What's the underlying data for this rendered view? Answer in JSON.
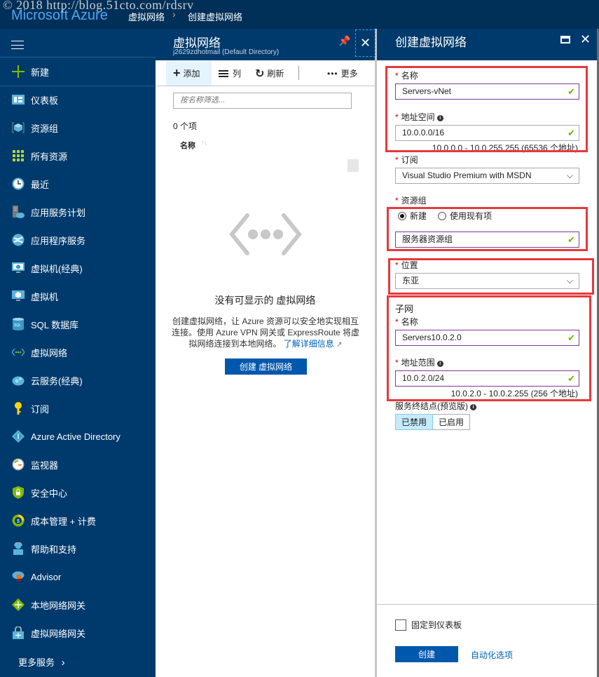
{
  "watermark": "© 2018 http://blog.51cto.com/rdsrv",
  "topbar": {
    "brand": "Microsoft Azure",
    "breadcrumb": [
      "虚拟网络",
      "创建虚拟网络"
    ],
    "breadcrumb_separator": "›"
  },
  "sidebar": {
    "new_label": "新建",
    "items": [
      {
        "label": "仪表板",
        "icon": "dashboard-icon"
      },
      {
        "label": "资源组",
        "icon": "resource-group-icon"
      },
      {
        "label": "所有资源",
        "icon": "all-resources-icon"
      },
      {
        "label": "最近",
        "icon": "clock-icon"
      },
      {
        "label": "应用服务计划",
        "icon": "app-service-plan-icon"
      },
      {
        "label": "应用程序服务",
        "icon": "app-services-icon"
      },
      {
        "label": "虚拟机(经典)",
        "icon": "vm-classic-icon"
      },
      {
        "label": "虚拟机",
        "icon": "vm-icon"
      },
      {
        "label": "SQL 数据库",
        "icon": "sql-database-icon"
      },
      {
        "label": "虚拟网络",
        "icon": "virtual-network-icon"
      },
      {
        "label": "云服务(经典)",
        "icon": "cloud-service-icon"
      },
      {
        "label": "订阅",
        "icon": "key-icon"
      },
      {
        "label": "Azure Active Directory",
        "icon": "active-directory-icon"
      },
      {
        "label": "监视器",
        "icon": "monitor-icon"
      },
      {
        "label": "安全中心",
        "icon": "shield-icon"
      },
      {
        "label": "成本管理 + 计费",
        "icon": "billing-icon"
      },
      {
        "label": "帮助和支持",
        "icon": "help-support-icon"
      },
      {
        "label": "Advisor",
        "icon": "advisor-icon"
      },
      {
        "label": "本地网络网关",
        "icon": "local-gateway-icon"
      },
      {
        "label": "虚拟网络网关",
        "icon": "vnet-gateway-icon"
      }
    ],
    "more_services": "更多服务",
    "more_chevron": "›"
  },
  "list_blade": {
    "title": "虚拟网络",
    "subtitle": "j2629zdhotmail (Default Directory)",
    "commands": {
      "add": "添加",
      "columns": "列",
      "refresh": "刷新",
      "more": "更多"
    },
    "filter_placeholder": "按名称筛选...",
    "item_count": "0 个项",
    "column_header": "名称",
    "sort_glyph": "↑↓",
    "empty_title": "没有可显示的 虚拟网络",
    "empty_desc": "创建虚拟网络，让 Azure 资源可以安全地实现相互连接。使用 Azure VPN 网关或 ExpressRoute 将虚拟网络连接到本地网络。",
    "learn_more": "了解详细信息",
    "create_button": "创建 虚拟网络"
  },
  "create_blade": {
    "title": "创建虚拟网络",
    "name": {
      "label": "名称",
      "value": "Servers-vNet"
    },
    "address_space": {
      "label": "地址空间",
      "value": "10.0.0.0/16",
      "hint": "10.0.0.0 - 10.0.255.255 (65536 个地址)"
    },
    "subscription": {
      "label": "订阅",
      "value": "Visual Studio Premium with MSDN"
    },
    "resource_group": {
      "label": "资源组",
      "option_new": "新建",
      "option_existing": "使用现有项",
      "selected": "新建",
      "value": "服务器资源组"
    },
    "location": {
      "label": "位置",
      "value": "东亚"
    },
    "subnet": {
      "section_title": "子网",
      "name": {
        "label": "名称",
        "value": "Servers10.0.2.0"
      },
      "address_range": {
        "label": "地址范围",
        "value": "10.0.2.0/24",
        "hint": "10.0.2.0 - 10.0.2.255 (256 个地址)"
      }
    },
    "service_endpoints": {
      "label": "服务终结点(预览版)",
      "options": [
        "已禁用",
        "已启用"
      ],
      "selected": "已禁用"
    },
    "pin_to_dashboard": {
      "label": "固定到仪表板",
      "checked": false
    },
    "create_button": "创建",
    "automation_link": "自动化选项",
    "required_mark": "*",
    "checkmark": "✔",
    "chevron": "⌵"
  },
  "colors": {
    "topbar": "#002f57",
    "sidebar": "#003a6c",
    "brand": "#4ca6f5",
    "primary_button": "#0058ad",
    "link": "#0062b8",
    "valid_check": "#6bb700",
    "focus_border": "#7d3a96",
    "highlight_box": "#e8383c"
  }
}
